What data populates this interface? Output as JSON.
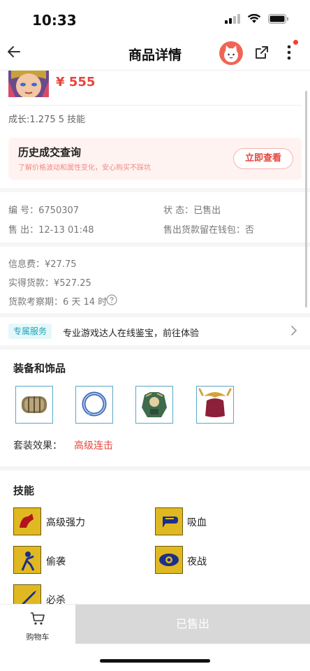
{
  "status": {
    "time": "10:33"
  },
  "nav": {
    "title": "商品详情"
  },
  "product": {
    "price": "¥ 555",
    "growth": "成长:1.275 5 技能"
  },
  "history": {
    "title": "历史成交查询",
    "subtitle": "了解价格波动和属性变化，安心购买不踩坑",
    "button": "立即查看"
  },
  "details": {
    "id": "编 号：6750307",
    "status": "状 态：已售出",
    "sold": "售 出：12-13 01:48",
    "wallet": "售出货款留在钱包：否"
  },
  "fees": {
    "info_fee": "信息费：¥27.75",
    "actual": "实得货款：¥527.25",
    "review": "货款考察期：6 天 14 时"
  },
  "service": {
    "tag": "专属服务",
    "text": "专业游戏达人在线鉴宝，前往体验"
  },
  "equipment": {
    "title": "装备和饰品",
    "items": [
      "bracer-icon",
      "ring-icon",
      "armor-icon",
      "helmet-icon"
    ],
    "set_label": "套装效果：",
    "set_value": "高级连击"
  },
  "skills": {
    "title": "技能",
    "items": [
      {
        "icon": "strength-skill-icon",
        "label": "高级强力"
      },
      {
        "icon": "lifesteal-skill-icon",
        "label": "吸血"
      },
      {
        "icon": "sneak-skill-icon",
        "label": "偷袭"
      },
      {
        "icon": "night-skill-icon",
        "label": "夜战"
      },
      {
        "icon": "critical-skill-icon",
        "label": "必杀"
      }
    ]
  },
  "bottom": {
    "cart_label": "购物车",
    "sold_label": "已售出"
  },
  "colors": {
    "accent_red": "#e8453c",
    "service_teal": "#1aa5b8"
  }
}
